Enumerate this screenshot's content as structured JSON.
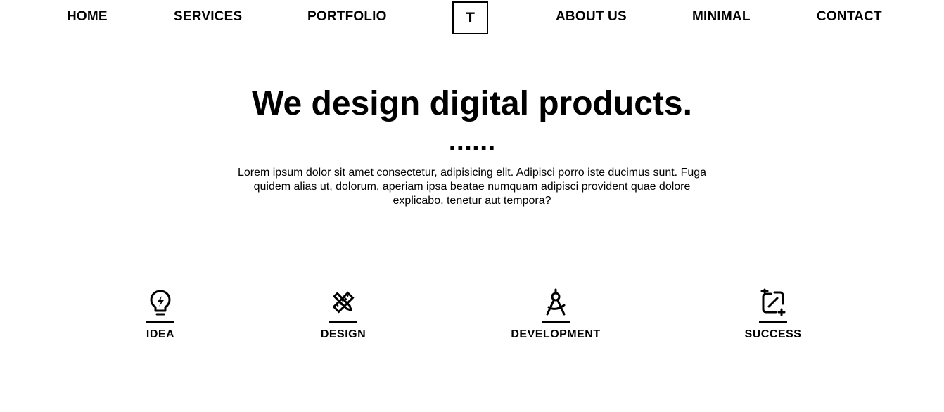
{
  "nav": {
    "items": [
      {
        "label": "HOME"
      },
      {
        "label": "SERVICES"
      },
      {
        "label": "PORTFOLIO"
      },
      {
        "label": "ABOUT US"
      },
      {
        "label": "MINIMAL"
      },
      {
        "label": "CONTACT"
      }
    ],
    "logo": "T"
  },
  "hero": {
    "title": "We design digital products.",
    "dots": "......",
    "intro": "Lorem ipsum dolor sit amet consectetur, adipisicing elit. Adipisci porro iste ducimus sunt. Fuga quidem alias ut, dolorum, aperiam ipsa beatae numquam adipisci provident quae dolore explicabo, tenetur aut tempora?"
  },
  "features": [
    {
      "label": "IDEA",
      "icon": "lightbulb-icon"
    },
    {
      "label": "DESIGN",
      "icon": "pencil-ruler-icon"
    },
    {
      "label": "DEVELOPMENT",
      "icon": "compass-icon"
    },
    {
      "label": "SUCCESS",
      "icon": "link-icon"
    }
  ]
}
